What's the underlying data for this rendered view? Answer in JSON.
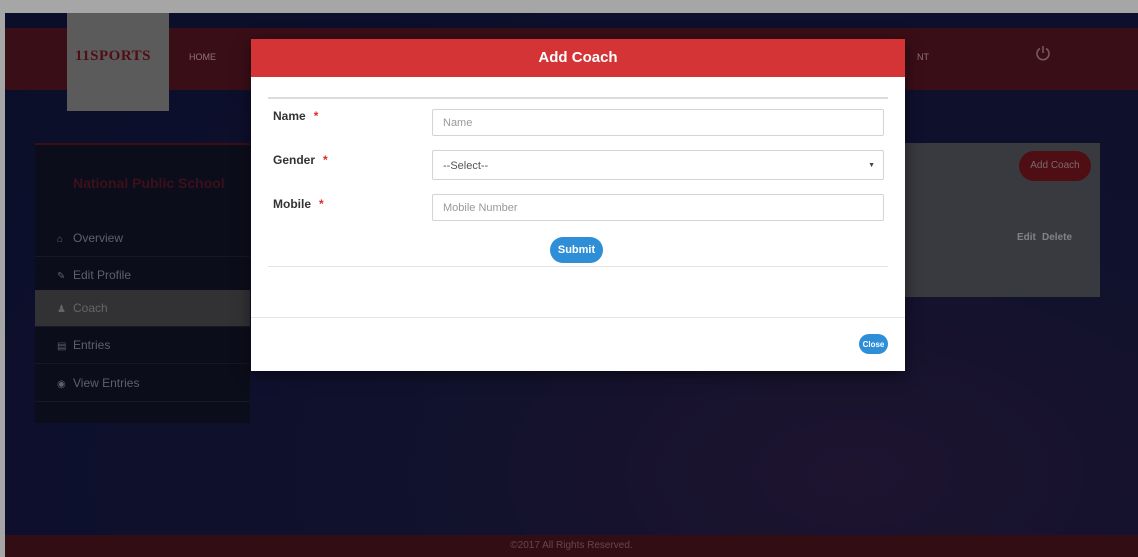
{
  "app": {
    "logo": "11SPORTS",
    "nav_home": "HOME",
    "nav_contact": "NT"
  },
  "sidebar": {
    "school_name": "National Public School",
    "items": [
      {
        "icon": "home-icon",
        "label": "Overview"
      },
      {
        "icon": "edit-icon",
        "label": "Edit Profile"
      },
      {
        "icon": "user-icon",
        "label": "Coach"
      },
      {
        "icon": "book-icon",
        "label": "Entries"
      },
      {
        "icon": "eye-icon",
        "label": "View Entries"
      }
    ],
    "active_index": 2
  },
  "content": {
    "add_coach_label": "Add Coach",
    "edit_label": "Edit",
    "delete_label": "Delete"
  },
  "modal": {
    "title": "Add Coach",
    "fields": {
      "name_label": "Name",
      "name_placeholder": "Name",
      "gender_label": "Gender",
      "gender_selected": "--Select--",
      "mobile_label": "Mobile",
      "mobile_placeholder": "Mobile Number"
    },
    "required_marker": "*",
    "submit_label": "Submit",
    "close_label": "Close"
  },
  "footer": {
    "text": "©2017 All Rights Reserved."
  },
  "colors": {
    "modal_header": "#d53437",
    "button_blue": "#2e8fd8",
    "required_red": "#e0292c",
    "header_bg": "#5a1624"
  }
}
